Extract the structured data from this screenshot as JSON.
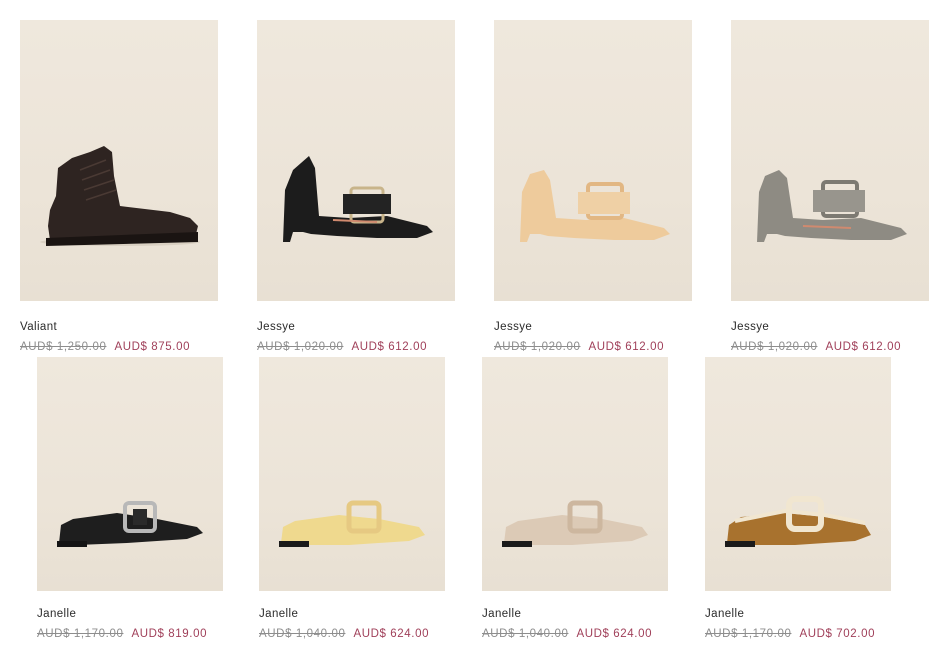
{
  "products": [
    {
      "name": "Valiant",
      "old_price": "AUD$ 1,250.00",
      "price": "AUD$ 875.00",
      "image": "dark brown lace-up boot",
      "color": "#2e2421"
    },
    {
      "name": "Jessye",
      "old_price": "AUD$ 1,020.00",
      "price": "AUD$ 612.00",
      "image": "black buckle pump",
      "color": "#1c1c1c"
    },
    {
      "name": "Jessye",
      "old_price": "AUD$ 1,020.00",
      "price": "AUD$ 612.00",
      "image": "nude buckle pump",
      "color": "#eecb9c"
    },
    {
      "name": "Jessye",
      "old_price": "AUD$ 1,020.00",
      "price": "AUD$ 612.00",
      "image": "grey buckle pump",
      "color": "#8e8b83"
    },
    {
      "name": "Janelle",
      "old_price": "AUD$ 1,170.00",
      "price": "AUD$ 819.00",
      "image": "black buckle loafer",
      "color": "#1e1e1e"
    },
    {
      "name": "Janelle",
      "old_price": "AUD$ 1,040.00",
      "price": "AUD$ 624.00",
      "image": "yellow buckle loafer",
      "color": "#efd98e"
    },
    {
      "name": "Janelle",
      "old_price": "AUD$ 1,040.00",
      "price": "AUD$ 624.00",
      "image": "beige buckle loafer",
      "color": "#dccab6"
    },
    {
      "name": "Janelle",
      "old_price": "AUD$ 1,170.00",
      "price": "AUD$ 702.00",
      "image": "tan suede shearling loafer",
      "color": "#a8722e"
    }
  ]
}
